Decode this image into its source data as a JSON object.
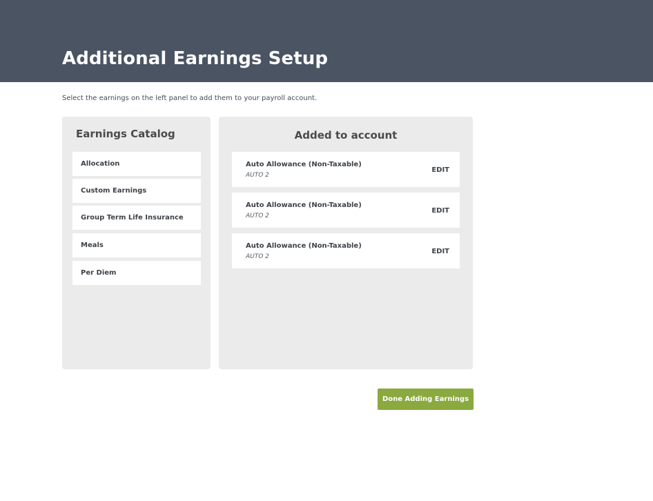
{
  "header": {
    "title": "Additional Earnings Setup"
  },
  "instructions": "Select the earnings on the left panel to add them to your payroll account.",
  "catalog": {
    "title": "Earnings Catalog",
    "items": [
      {
        "label": "Allocation"
      },
      {
        "label": "Custom Earnings"
      },
      {
        "label": "Group Term Life Insurance"
      },
      {
        "label": "Meals"
      },
      {
        "label": "Per Diem"
      }
    ]
  },
  "added": {
    "title": "Added to account",
    "edit_label": "EDIT",
    "items": [
      {
        "name": "Auto Allowance (Non-Taxable)",
        "code": "AUTO 2"
      },
      {
        "name": "Auto Allowance (Non-Taxable)",
        "code": "AUTO 2"
      },
      {
        "name": "Auto Allowance (Non-Taxable)",
        "code": "AUTO 2"
      }
    ]
  },
  "actions": {
    "done_label": "Done Adding Earnings"
  },
  "colors": {
    "header_bg": "#4a5463",
    "panel_bg": "#ebebeb",
    "accent": "#8aa93f"
  }
}
